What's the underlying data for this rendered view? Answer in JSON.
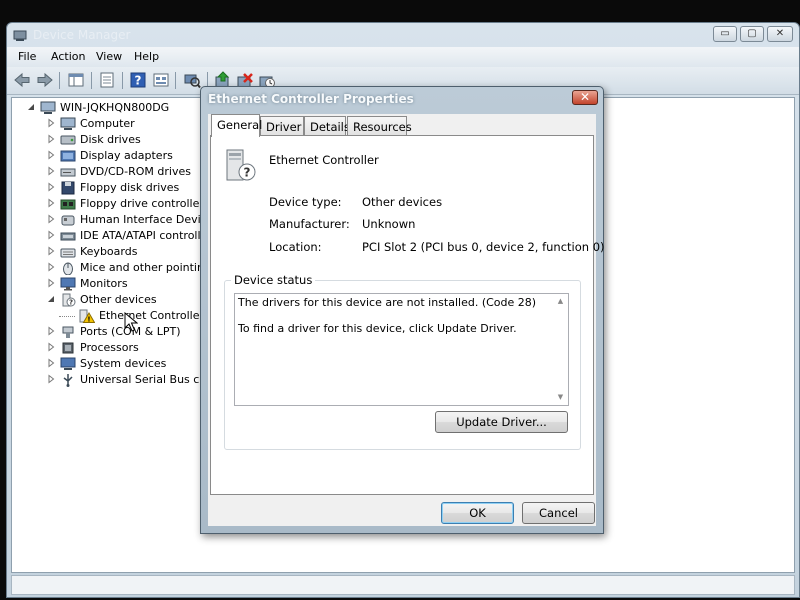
{
  "main_window": {
    "title": "Device Manager",
    "controls": {
      "minimize": "▭",
      "maximize": "▢",
      "close": "✕"
    }
  },
  "menu": [
    "File",
    "Action",
    "View",
    "Help"
  ],
  "toolbar": {
    "icons": [
      "back-arrow-icon",
      "forward-arrow-icon",
      "show-hide-tree-icon",
      "properties-icon",
      "help-icon",
      "view-icon",
      "scan-hardware-icon",
      "update-driver-icon",
      "uninstall-icon",
      "disable-device-icon"
    ]
  },
  "tree": {
    "root": "WIN-JQKHQN800DG",
    "items": [
      {
        "label": "Computer",
        "icon": "computer-icon"
      },
      {
        "label": "Disk drives",
        "icon": "disk-drive-icon"
      },
      {
        "label": "Display adapters",
        "icon": "display-adapter-icon"
      },
      {
        "label": "DVD/CD-ROM drives",
        "icon": "dvd-drive-icon"
      },
      {
        "label": "Floppy disk drives",
        "icon": "floppy-disk-icon"
      },
      {
        "label": "Floppy drive controllers",
        "icon": "floppy-controller-icon"
      },
      {
        "label": "Human Interface Devices",
        "icon": "hid-icon"
      },
      {
        "label": "IDE ATA/ATAPI controllers",
        "icon": "ide-controller-icon"
      },
      {
        "label": "Keyboards",
        "icon": "keyboard-icon"
      },
      {
        "label": "Mice and other pointing de",
        "icon": "mouse-icon"
      },
      {
        "label": "Monitors",
        "icon": "monitor-icon"
      },
      {
        "label": "Other devices",
        "icon": "other-devices-icon",
        "expanded": true
      },
      {
        "label": "Ethernet Controller",
        "icon": "warning-device-icon",
        "child": true
      },
      {
        "label": "Ports (COM & LPT)",
        "icon": "port-icon"
      },
      {
        "label": "Processors",
        "icon": "processor-icon"
      },
      {
        "label": "System devices",
        "icon": "system-devices-icon"
      },
      {
        "label": "Universal Serial Bus contro",
        "icon": "usb-icon"
      }
    ]
  },
  "dialog": {
    "title": "Ethernet Controller Properties",
    "close": "✕",
    "tabs": [
      "General",
      "Driver",
      "Details",
      "Resources"
    ],
    "active_tab": "General",
    "device_name": "Ethernet Controller",
    "properties": [
      {
        "label": "Device type:",
        "value": "Other devices"
      },
      {
        "label": "Manufacturer:",
        "value": "Unknown"
      },
      {
        "label": "Location:",
        "value": "PCI Slot 2 (PCI bus 0, device 2, function 0)"
      }
    ],
    "status_group": "Device status",
    "status_lines": [
      "The drivers for this device are not installed. (Code 28)",
      "To find a driver for this device, click Update Driver."
    ],
    "update_driver": "Update Driver...",
    "ok": "OK",
    "cancel": "Cancel"
  }
}
